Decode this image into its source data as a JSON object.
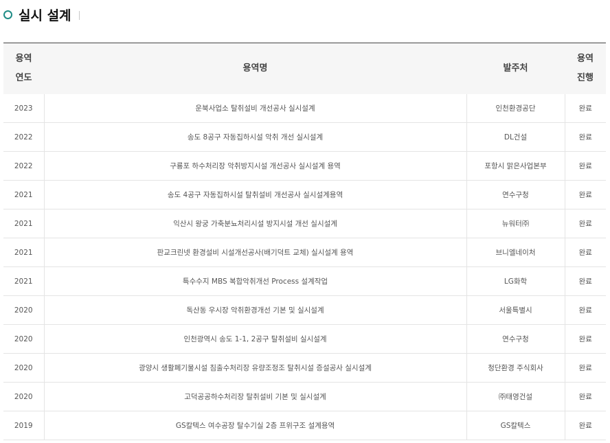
{
  "page": {
    "title": "실시 설계"
  },
  "table": {
    "headers": {
      "year_line1": "용역",
      "year_line2": "연도",
      "name": "용역명",
      "client": "발주처",
      "status_line1": "용역",
      "status_line2": "진행"
    },
    "rows": [
      {
        "year": "2023",
        "name": "운북사업소 탈취설비 개선공사 실시설계",
        "client": "인천환경공단",
        "status": "완료"
      },
      {
        "year": "2022",
        "name": "송도 8공구 자동집하시설 악취 개선 실시설계",
        "client": "DL건설",
        "status": "완료"
      },
      {
        "year": "2022",
        "name": "구룡포 하수처리장 악취방지시설 개선공사 실시설계 용역",
        "client": "포항시 맑은사업본부",
        "status": "완료"
      },
      {
        "year": "2021",
        "name": "송도 4공구 자동집하시설 탈취설비 개선공사 실시설계용역",
        "client": "연수구청",
        "status": "완료"
      },
      {
        "year": "2021",
        "name": "익산시 왕궁 가축분뇨처리시설 방지시설 개선 실시설계",
        "client": "뉴워터㈜",
        "status": "완료"
      },
      {
        "year": "2021",
        "name": "판교크린넷 환경설비 시설개선공사(배기덕트 교체) 실시설계 용역",
        "client": "브니엘네이처",
        "status": "완료"
      },
      {
        "year": "2021",
        "name": "특수수지 MBS 복합악취개선 Process 설계작업",
        "client": "LG화학",
        "status": "완료"
      },
      {
        "year": "2020",
        "name": "독산동 우시장 악취환경개선 기본 및 실시설계",
        "client": "서울특별시",
        "status": "완료"
      },
      {
        "year": "2020",
        "name": "인천광역시 송도 1-1, 2공구 탈취설비 실시설계",
        "client": "연수구청",
        "status": "완료"
      },
      {
        "year": "2020",
        "name": "광양시 생활폐기물시설 침출수처리장 유량조정조 탈취시설 증설공사 실시설계",
        "client": "청단환경 주식회사",
        "status": "완료"
      },
      {
        "year": "2020",
        "name": "고덕공공하수처리장 탈취설비 기본 및 실시설계",
        "client": "㈜태영건설",
        "status": "완료"
      },
      {
        "year": "2019",
        "name": "GS칼텍스 여수공장 탈수기실 2층 프위구조 설계용역",
        "client": "GS칼텍스",
        "status": "완료"
      }
    ]
  },
  "colors": {
    "accent": "#1f8c86",
    "header_bg": "#f6f6f6",
    "border": "#e4e4e4"
  }
}
